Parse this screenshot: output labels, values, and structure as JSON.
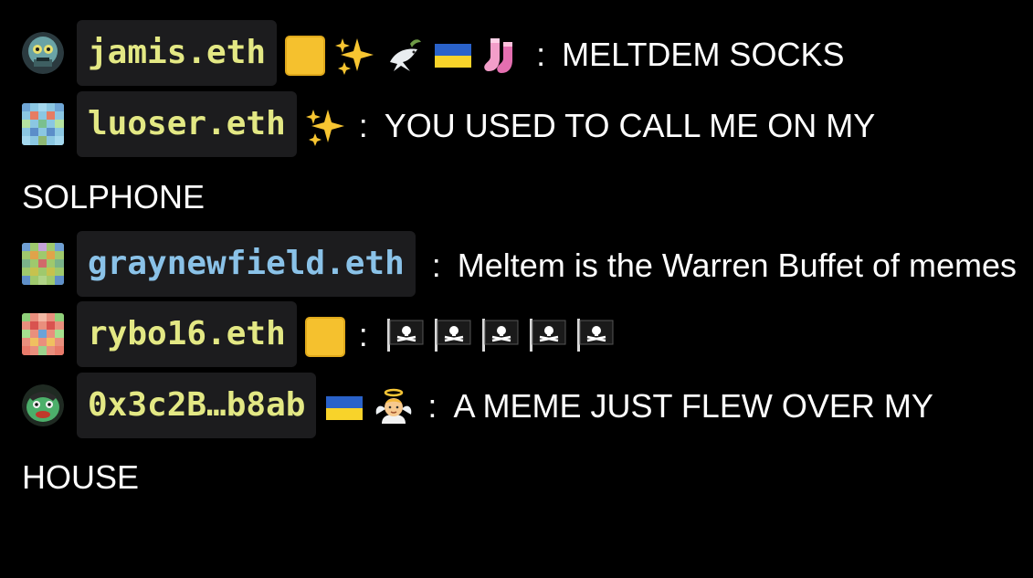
{
  "colors": {
    "background": "#000000",
    "name_bg": "#1c1c1e",
    "name_yellow": "#e3e884",
    "name_blue": "#8ac2e8",
    "text": "#ffffff"
  },
  "separator": ":",
  "messages": [
    {
      "name": "jamis.eth",
      "name_color": "#e3e884",
      "avatar": "zombie-face-avatar",
      "badges": [
        "yellow-square-icon",
        "sparkles-icon",
        "dove-icon",
        "ukraine-flag-icon",
        "socks-icon"
      ],
      "text": "MELTDEM SOCKS"
    },
    {
      "name": "luoser.eth",
      "name_color": "#e3e884",
      "avatar": "pixel-blue-avatar",
      "badges": [
        "sparkles-icon"
      ],
      "text": "YOU USED TO CALL ME ON MY SOLPHONE"
    },
    {
      "name": "graynewfield.eth",
      "name_color": "#8ac2e8",
      "avatar": "pixel-green-avatar",
      "badges": [],
      "text": "Meltem is the Warren Buffet of memes"
    },
    {
      "name": "rybo16.eth",
      "name_color": "#e3e884",
      "avatar": "pixel-red-avatar",
      "badges": [
        "yellow-square-icon"
      ],
      "text": "",
      "pirate_flags": 5
    },
    {
      "name": "0x3c2B…b8ab",
      "name_color": "#e3e884",
      "avatar": "green-face-avatar",
      "badges": [
        "ukraine-flag-icon",
        "baby-angel-icon"
      ],
      "text": "A MEME JUST FLEW OVER MY HOUSE"
    }
  ]
}
